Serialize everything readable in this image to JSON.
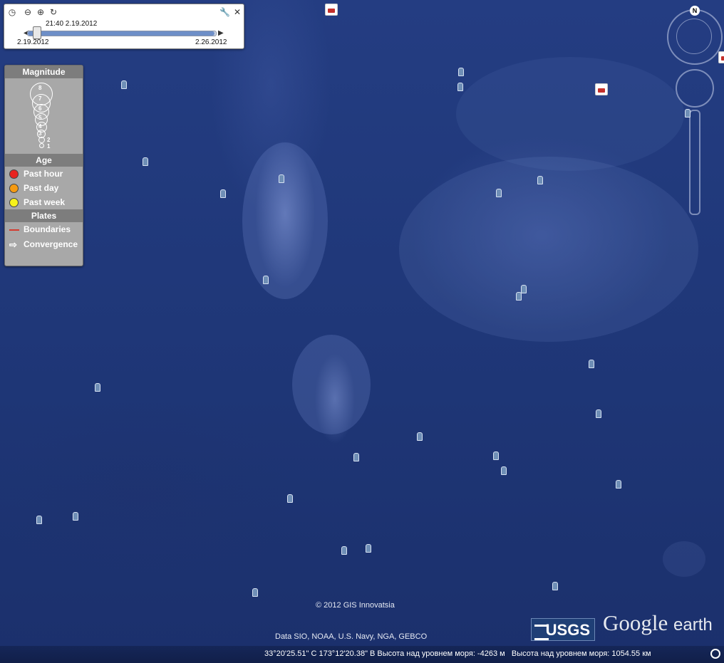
{
  "time_slider": {
    "current_time": "21:40 2.19.2012",
    "start_date": "2.19.2012",
    "end_date": "2.26.2012"
  },
  "legend": {
    "magnitude_title": "Magnitude",
    "magnitudes": [
      "8",
      "7",
      "6",
      "5",
      "4",
      "3",
      "2",
      "1"
    ],
    "age_title": "Age",
    "age_items": [
      {
        "label": "Past hour",
        "color": "#e8231f"
      },
      {
        "label": "Past day",
        "color": "#f59a12"
      },
      {
        "label": "Past week",
        "color": "#f7f21a"
      }
    ],
    "plates_title": "Plates",
    "plates_items": [
      {
        "label": "Boundaries"
      },
      {
        "label": "Convergence"
      }
    ]
  },
  "navigation": {
    "north_label": "N"
  },
  "attribution": {
    "copyright": "© 2012 GIS Innovatsia",
    "data_sources": "Data SIO, NOAA, U.S. Navy, NGA, GEBCO",
    "usgs": "USGS",
    "google_earth_1": "Google",
    "google_earth_2": "earth"
  },
  "status": {
    "coordinates": "33°20'25.51\" С  173°12'20.38\" В Высота над уровнем моря: -4263 м",
    "eye_altitude": "Высота над уровнем моря:  1054.55 км"
  },
  "colors": {
    "ocean": "#1f3778",
    "legend_bg": "#a8a8a8",
    "boundary_line": "#d43b2f"
  }
}
